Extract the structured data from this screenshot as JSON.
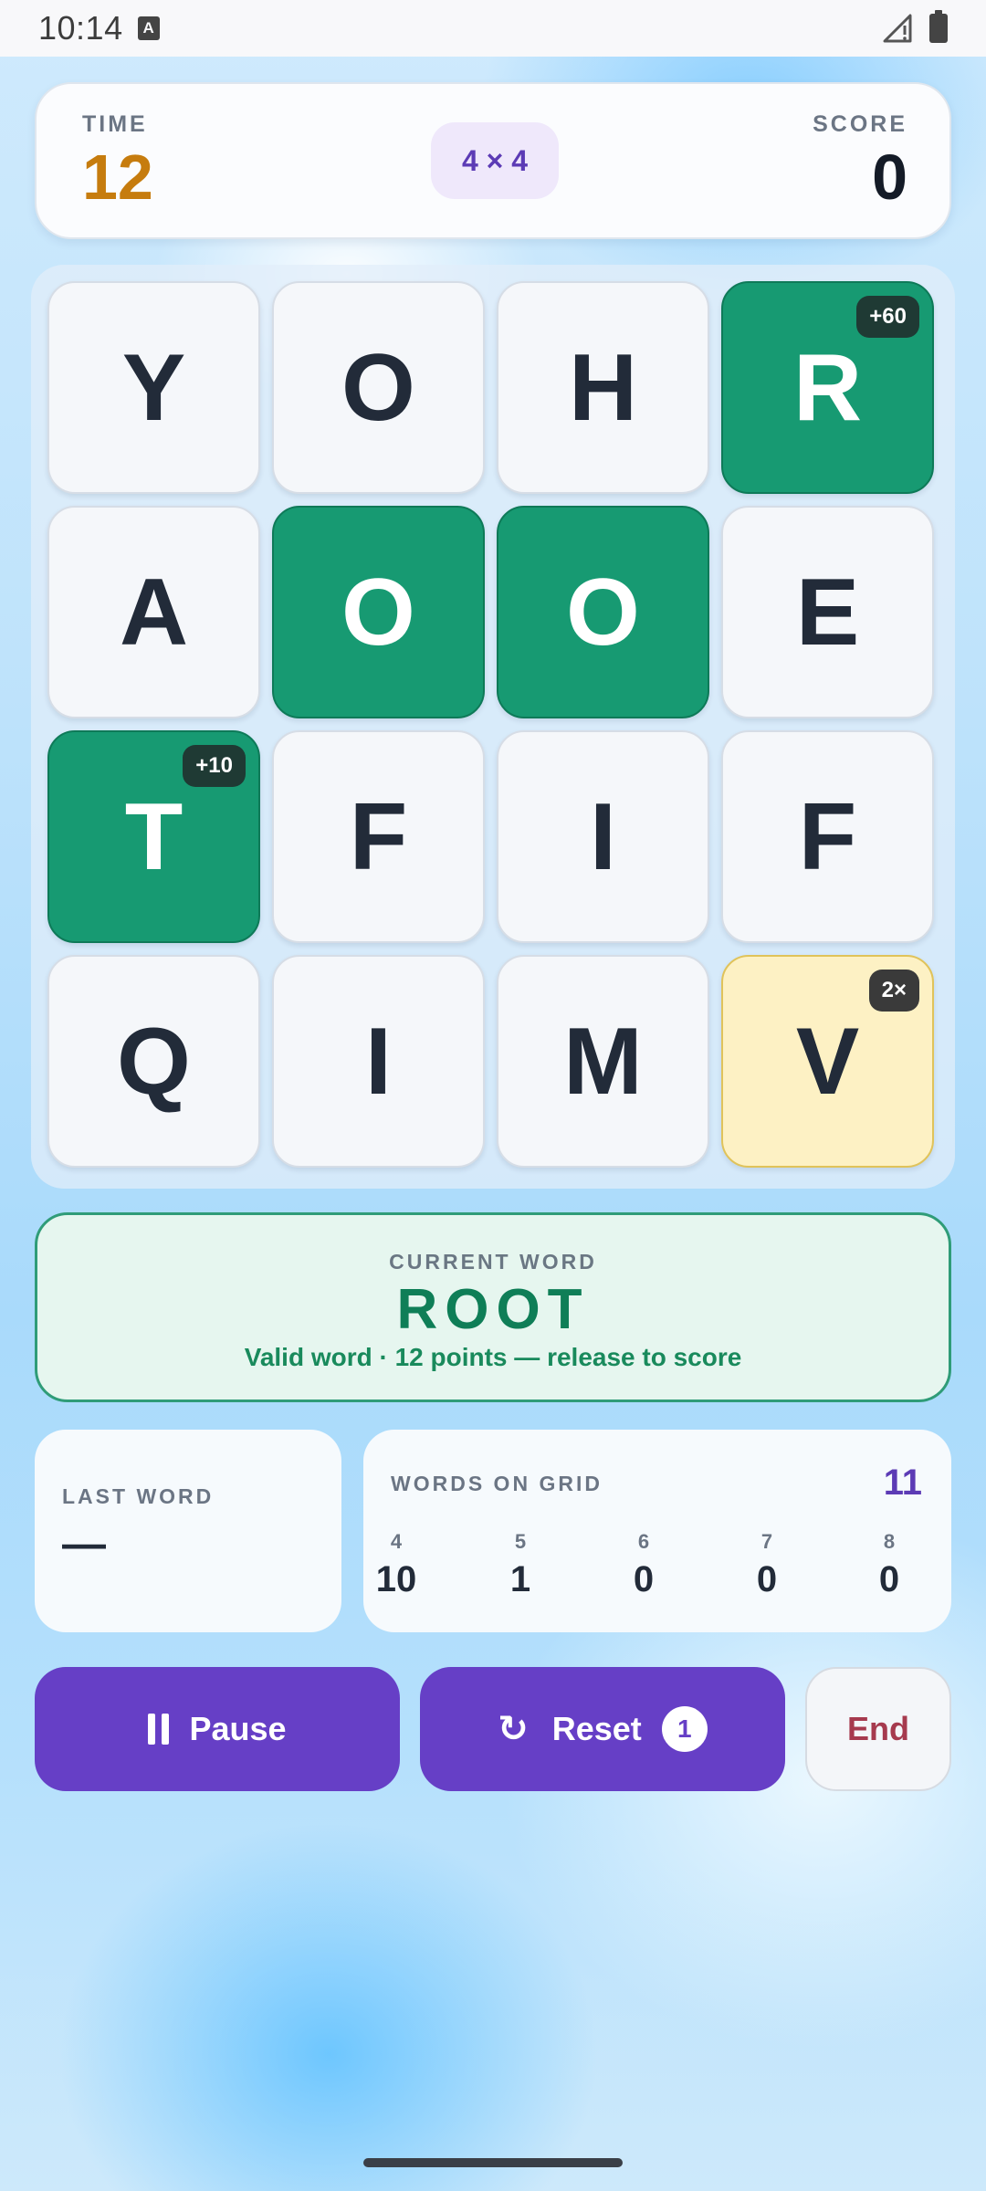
{
  "status_bar": {
    "time": "10:14",
    "keyboard_badge": "A"
  },
  "header": {
    "time_label": "TIME",
    "time_value": "12",
    "grid_size": "4 × 4",
    "score_label": "SCORE",
    "score_value": "0"
  },
  "board": {
    "rows": [
      [
        {
          "letter": "Y"
        },
        {
          "letter": "O"
        },
        {
          "letter": "H"
        },
        {
          "letter": "R",
          "state": "selected",
          "tag": "+60"
        }
      ],
      [
        {
          "letter": "A"
        },
        {
          "letter": "O",
          "state": "selected"
        },
        {
          "letter": "O",
          "state": "selected"
        },
        {
          "letter": "E"
        }
      ],
      [
        {
          "letter": "T",
          "state": "selected",
          "tag": "+10"
        },
        {
          "letter": "F"
        },
        {
          "letter": "I"
        },
        {
          "letter": "F"
        }
      ],
      [
        {
          "letter": "Q"
        },
        {
          "letter": "I"
        },
        {
          "letter": "M"
        },
        {
          "letter": "V",
          "state": "bonus",
          "tag": "2×"
        }
      ]
    ]
  },
  "current_word": {
    "label": "CURRENT WORD",
    "value": "ROOT",
    "status": "Valid word · 12 points — release to score"
  },
  "last_word": {
    "label": "LAST WORD",
    "value": "—"
  },
  "words_on_grid": {
    "label": "WORDS ON GRID",
    "total": "11",
    "breakdown": [
      {
        "length": "4",
        "count": "10"
      },
      {
        "length": "5",
        "count": "1"
      },
      {
        "length": "6",
        "count": "0"
      },
      {
        "length": "7",
        "count": "0"
      },
      {
        "length": "8",
        "count": "0"
      }
    ]
  },
  "actions": {
    "pause_label": "Pause",
    "reset_label": "Reset",
    "reset_count": "1",
    "end_label": "End"
  },
  "colors": {
    "selected_tile": "#179a72",
    "bonus_tile": "#fdf1c4",
    "primary_button": "#663fc6",
    "time_value": "#c67c0e"
  }
}
